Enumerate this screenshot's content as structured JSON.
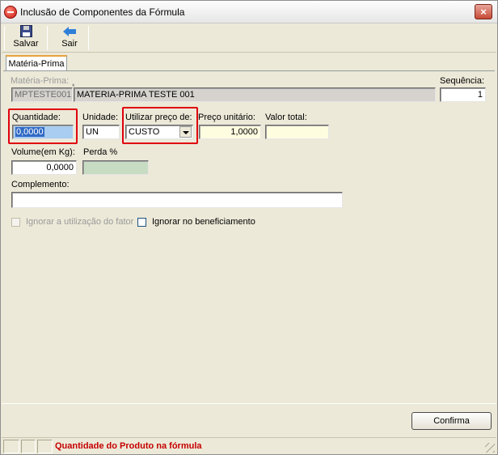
{
  "window": {
    "title": "Inclusão de Componentes da Fórmula",
    "close_label": "×"
  },
  "toolbar": {
    "save_label": "Salvar",
    "exit_label": "Sair"
  },
  "tabs": [
    {
      "label": "Matéria-Prima",
      "active": true
    }
  ],
  "form": {
    "materia_prima": {
      "label": "Matéria-Prima:",
      "code": "MPTESTE001",
      "name": "MATERIA-PRIMA TESTE 001"
    },
    "sequencia": {
      "label": "Sequência:",
      "value": "1"
    },
    "quantidade": {
      "label": "Quantidade:",
      "value": "0,0000"
    },
    "unidade": {
      "label": "Unidade:",
      "value": "UN"
    },
    "utilizar_preco": {
      "label": "Utilizar preço de:",
      "value": "CUSTO"
    },
    "preco_unitario": {
      "label": "Preço unitário:",
      "value": "1,0000"
    },
    "valor_total": {
      "label": "Valor total:",
      "value": ""
    },
    "volume": {
      "label": "Volume(em Kg):",
      "value": "0,0000"
    },
    "perda": {
      "label": "Perda %",
      "value": ""
    },
    "complemento": {
      "label": "Complemento:",
      "value": ""
    },
    "ignorar_fator": {
      "label": "Ignorar a utilização do fator",
      "checked": false,
      "enabled": false
    },
    "ignorar_beneficiamento": {
      "label": "Ignorar no beneficiamento",
      "checked": false,
      "enabled": true
    }
  },
  "actions": {
    "confirm_label": "Confirma"
  },
  "status": {
    "message": "Quantidade do Produto na fórmula"
  },
  "colors": {
    "highlight": "#e0000f",
    "status_text": "#c60000",
    "window_bg": "#ece9d8"
  }
}
